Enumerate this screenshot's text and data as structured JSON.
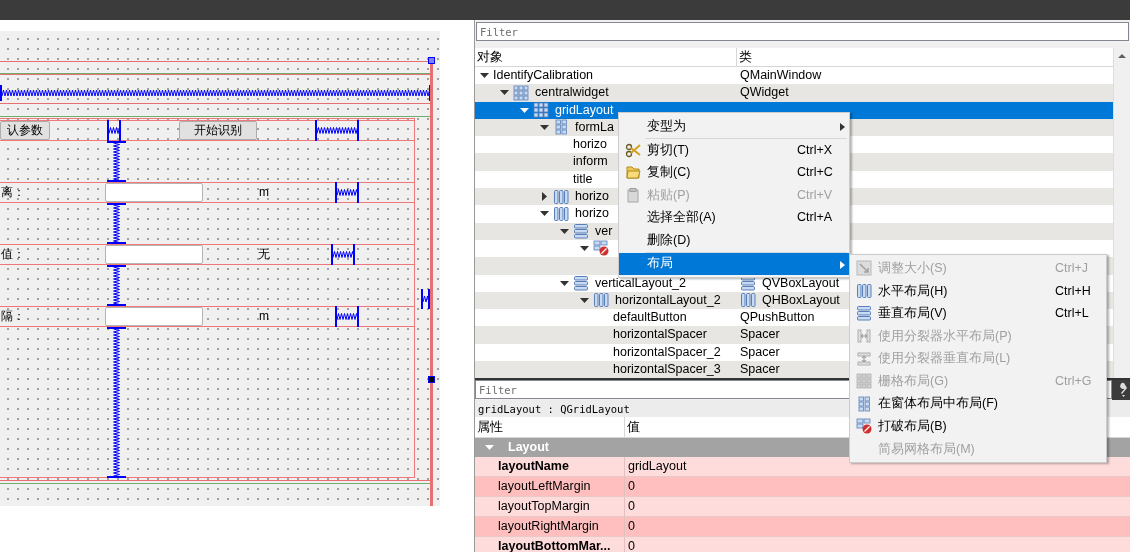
{
  "form_canvas": {
    "buttons": [
      "认参数",
      "开始识别"
    ],
    "fields": [
      {
        "label": "离：",
        "unit": "m"
      },
      {
        "label": "值：",
        "unit": "无"
      },
      {
        "label": "隔：",
        "unit": "m"
      }
    ]
  },
  "object_inspector": {
    "filter": {
      "placeholder": "Filter"
    },
    "columns": [
      "对象",
      "类"
    ],
    "items": [
      {
        "name": "IdentifyCalibration",
        "class": "QMainWindow",
        "expanded": true,
        "selected": false,
        "children": [
          {
            "name": "centralwidget",
            "kind": "grid",
            "class": "QWidget",
            "expanded": true,
            "selected": false,
            "children": [
              {
                "name": "gridLayout",
                "kind": "grid",
                "expanded": true,
                "selected": true,
                "children": [
                  {
                    "name": "formLa",
                    "kind": "form",
                    "expanded": true,
                    "selected": false,
                    "children": [
                      {
                        "name": "horizo",
                        "selected": false
                      },
                      {
                        "name": "inform",
                        "selected": false
                      },
                      {
                        "name": "title",
                        "selected": false
                      }
                    ]
                  },
                  {
                    "name": "horizo",
                    "kind": "hbox",
                    "expanded": false,
                    "selected": false
                  },
                  {
                    "name": "horizo",
                    "kind": "hbox",
                    "expanded": true,
                    "selected": false,
                    "children": [
                      {
                        "name": "ver",
                        "kind": "vbox",
                        "expanded": true,
                        "selected": false,
                        "children": [
                          {
                            "kind": "break",
                            "expanded": true,
                            "selected": false,
                            "children": [
                              {
                                "selected": false
                              }
                            ]
                          }
                        ]
                      },
                      {
                        "name": "verticalLayout_2",
                        "kind": "vbox",
                        "class": "QVBoxLayout",
                        "class_icon": true,
                        "expanded": true,
                        "selected": false,
                        "children": [
                          {
                            "name": "horizontalLayout_2",
                            "kind": "hbox",
                            "class": "QHBoxLayout",
                            "class_icon": true,
                            "expanded": true,
                            "selected": false,
                            "children": [
                              {
                                "name": "defaultButton",
                                "class": "QPushButton",
                                "selected": false
                              },
                              {
                                "name": "horizontalSpacer",
                                "class": "Spacer",
                                "selected": false
                              },
                              {
                                "name": "horizontalSpacer_2",
                                "class": "Spacer",
                                "selected": false
                              },
                              {
                                "name": "horizontalSpacer_3",
                                "class": "Spacer",
                                "selected": false
                              }
                            ]
                          }
                        ]
                      }
                    ]
                  }
                ]
              }
            ]
          }
        ]
      }
    ]
  },
  "context_menu": {
    "items": [
      {
        "kind": "plain",
        "label": "变型为",
        "submenu": true,
        "disabled": false,
        "selected": false
      },
      {
        "kind": "separator"
      },
      {
        "kind": "cut",
        "label": "剪切(T)",
        "shortcut": "Ctrl+X",
        "disabled": false,
        "selected": false
      },
      {
        "kind": "copy",
        "label": "复制(C)",
        "shortcut": "Ctrl+C",
        "disabled": false,
        "selected": false
      },
      {
        "kind": "paste",
        "label": "粘贴(P)",
        "shortcut": "Ctrl+V",
        "disabled": true,
        "selected": false
      },
      {
        "kind": "plain",
        "label": "选择全部(A)",
        "shortcut": "Ctrl+A",
        "disabled": false,
        "selected": false
      },
      {
        "kind": "plain",
        "label": "删除(D)",
        "disabled": false,
        "selected": false
      },
      {
        "kind": "separator"
      },
      {
        "kind": "plain",
        "label": "布局",
        "submenu": true,
        "disabled": false,
        "selected": true
      }
    ]
  },
  "layout_submenu": {
    "items": [
      {
        "kind": "resize",
        "label": "调整大小(S)",
        "shortcut": "Ctrl+J",
        "disabled": true,
        "selected": false
      },
      {
        "kind": "hbox",
        "label": "水平布局(H)",
        "shortcut": "Ctrl+H",
        "disabled": false,
        "selected": false
      },
      {
        "kind": "vbox",
        "label": "垂直布局(V)",
        "shortcut": "Ctrl+L",
        "disabled": false,
        "selected": false
      },
      {
        "kind": "hsplit",
        "label": "使用分裂器水平布局(P)",
        "disabled": true,
        "selected": false
      },
      {
        "kind": "vsplit",
        "label": "使用分裂器垂直布局(L)",
        "disabled": true,
        "selected": false
      },
      {
        "kind": "grid",
        "label": "栅格布局(G)",
        "shortcut": "Ctrl+G",
        "disabled": true,
        "selected": false
      },
      {
        "kind": "form",
        "label": "在窗体布局中布局(F)",
        "disabled": false,
        "selected": false
      },
      {
        "kind": "break",
        "label": "打破布局(B)",
        "disabled": false,
        "selected": false
      },
      {
        "kind": "plain",
        "label": "简易网格布局(M)",
        "disabled": true,
        "selected": false
      }
    ]
  },
  "property_editor": {
    "filter": {
      "placeholder": "Filter"
    },
    "object_label": "gridLayout : QGridLayout",
    "columns": [
      "属性",
      "值"
    ],
    "groups": [
      {
        "name": "Layout",
        "expanded": true,
        "properties": [
          {
            "name": "layoutName",
            "value": "gridLayout",
            "modified": true
          },
          {
            "name": "layoutLeftMargin",
            "value": "0",
            "modified": false
          },
          {
            "name": "layoutTopMargin",
            "value": "0",
            "modified": false
          },
          {
            "name": "layoutRightMargin",
            "value": "0",
            "modified": false
          },
          {
            "name": "layoutBottomMar...",
            "value": "0",
            "modified": true
          }
        ]
      }
    ]
  }
}
